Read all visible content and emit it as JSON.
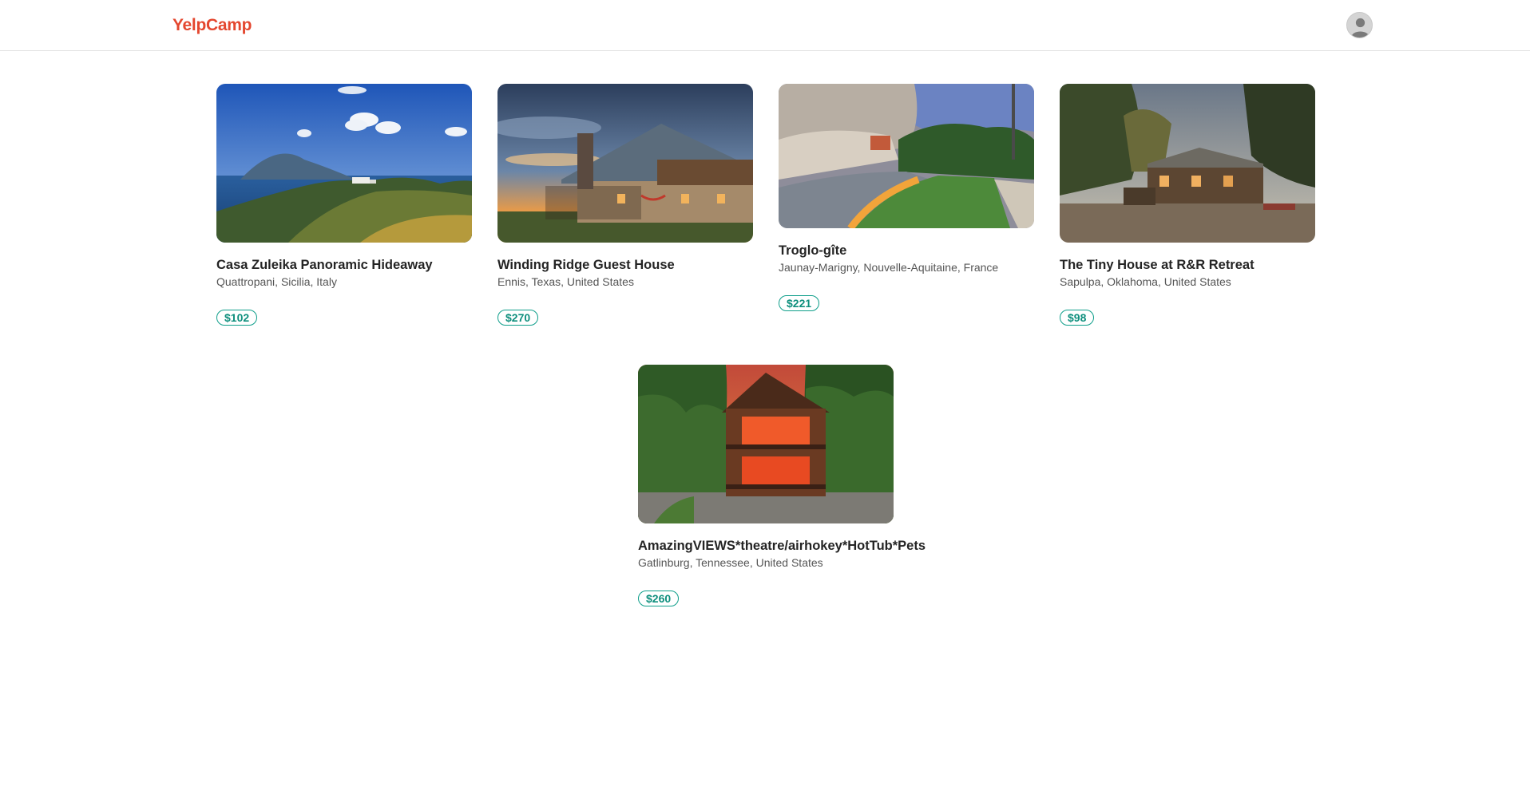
{
  "app": {
    "brand": "YelpCamp"
  },
  "header": {
    "avatar_icon": "user-avatar-icon"
  },
  "colors": {
    "brand": "#e4472f",
    "price": "#0e9e8a"
  },
  "listings": [
    {
      "title": "Casa Zuleika Panoramic Hideaway",
      "location": "Quattropani, Sicilia, Italy",
      "price": "$102"
    },
    {
      "title": "Winding Ridge Guest House",
      "location": "Ennis, Texas, United States",
      "price": "$270"
    },
    {
      "title": "Troglo-gîte",
      "location": "Jaunay-Marigny, Nouvelle-Aquitaine, France",
      "price": "$221"
    },
    {
      "title": "The Tiny House at R&R Retreat",
      "location": "Sapulpa, Oklahoma, United States",
      "price": "$98"
    },
    {
      "title": "AmazingVIEWS*theatre/airhokey*HotTub*Pets",
      "location": "Gatlinburg, Tennessee, United States",
      "price": "$260"
    }
  ]
}
